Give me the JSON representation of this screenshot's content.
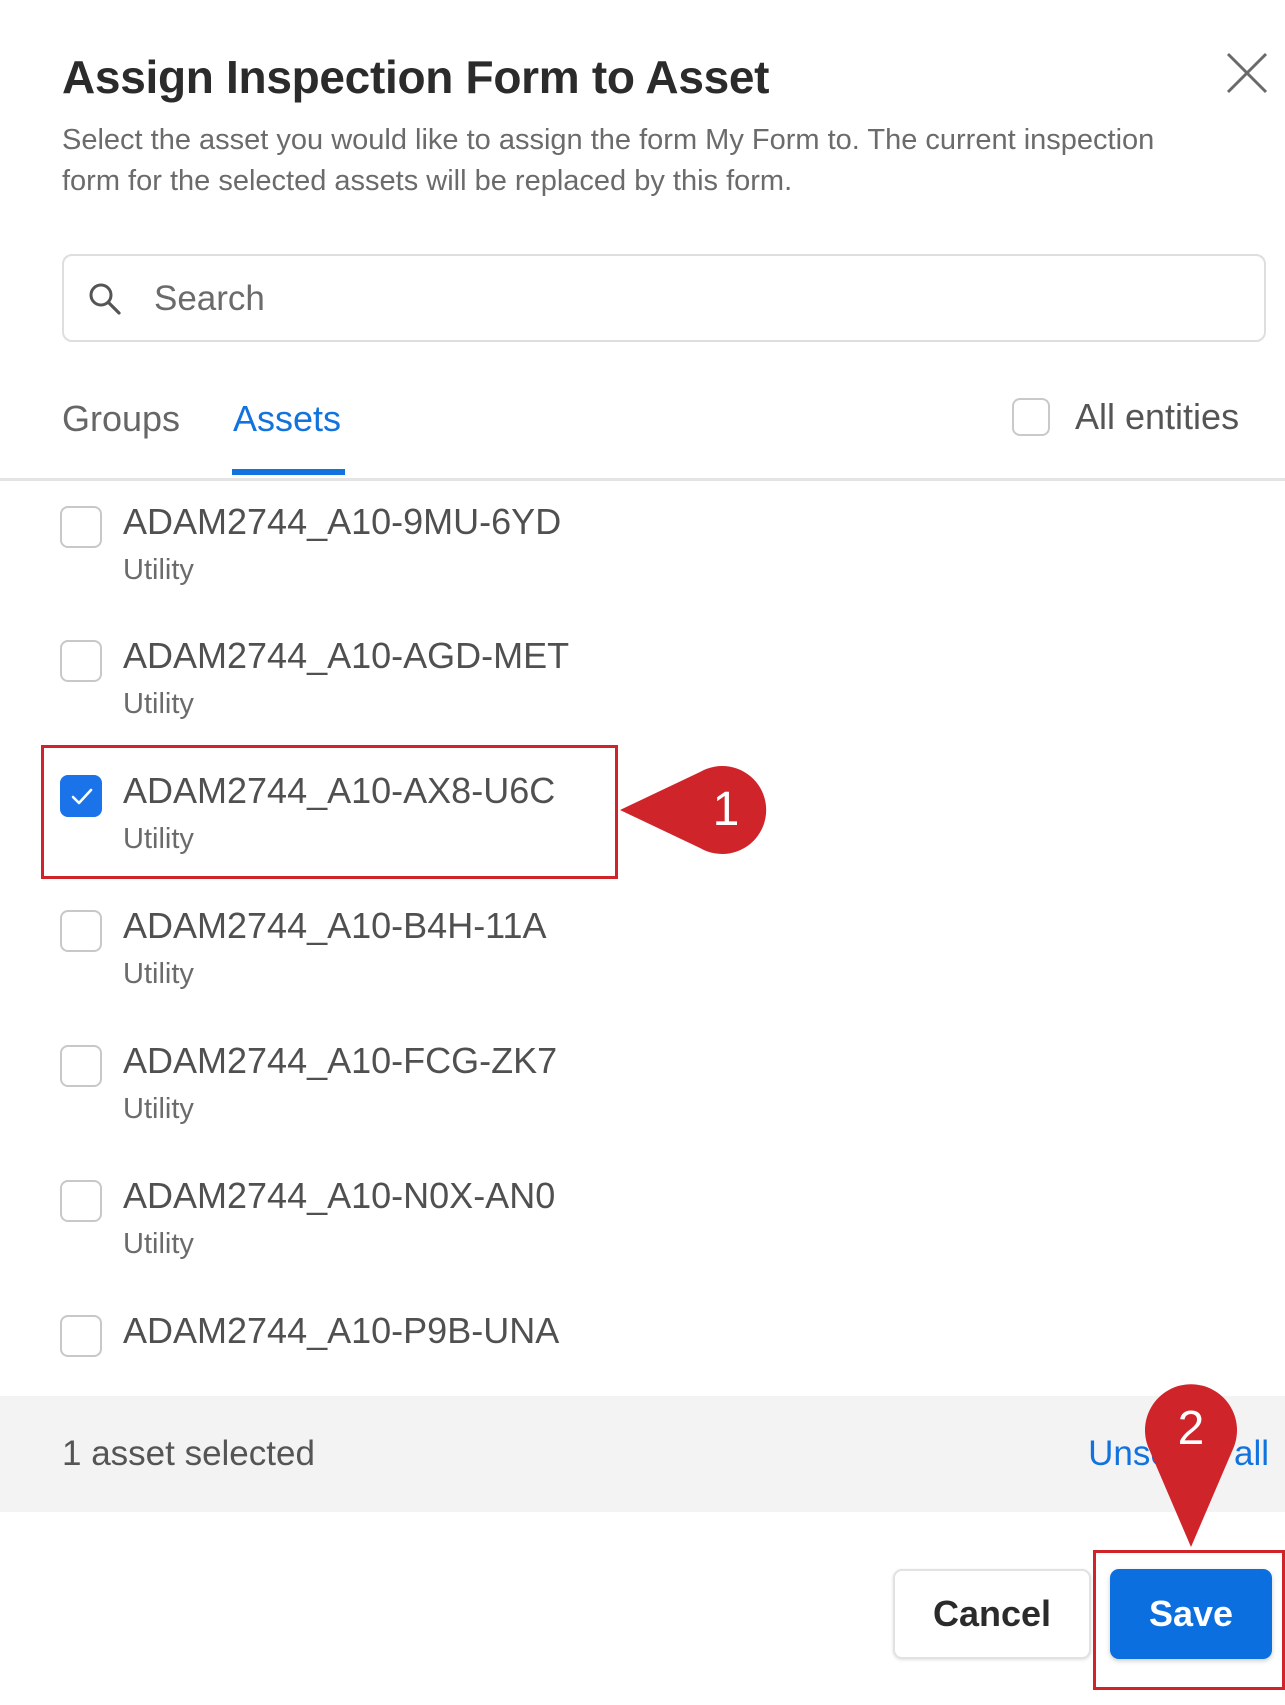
{
  "dialog": {
    "title": "Assign Inspection Form to Asset",
    "subtitle": "Select the asset you would like to assign the form My Form to. The current inspection form for the selected assets will be replaced by this form."
  },
  "search": {
    "placeholder": "Search",
    "value": ""
  },
  "tabs": [
    {
      "label": "Groups",
      "active": false
    },
    {
      "label": "Assets",
      "active": true
    }
  ],
  "all_entities": {
    "label": "All entities",
    "checked": false
  },
  "assets": [
    {
      "name": "ADAM2744_A10-9MU-6YD",
      "type": "Utility",
      "checked": false
    },
    {
      "name": "ADAM2744_A10-AGD-MET",
      "type": "Utility",
      "checked": false
    },
    {
      "name": "ADAM2744_A10-AX8-U6C",
      "type": "Utility",
      "checked": true
    },
    {
      "name": "ADAM2744_A10-B4H-11A",
      "type": "Utility",
      "checked": false
    },
    {
      "name": "ADAM2744_A10-FCG-ZK7",
      "type": "Utility",
      "checked": false
    },
    {
      "name": "ADAM2744_A10-N0X-AN0",
      "type": "Utility",
      "checked": false
    },
    {
      "name": "ADAM2744_A10-P9B-UNA",
      "type": "",
      "checked": false
    }
  ],
  "footer": {
    "selected_count": "1 asset selected",
    "unselect_all": "Unselect all"
  },
  "buttons": {
    "cancel": "Cancel",
    "save": "Save"
  },
  "callouts": {
    "step1": "1",
    "step2": "2"
  },
  "colors": {
    "accent": "#1273de",
    "callout": "#d0242b",
    "save": "#0b6fe0"
  },
  "icons": [
    "close-icon",
    "search-icon",
    "check-icon"
  ]
}
